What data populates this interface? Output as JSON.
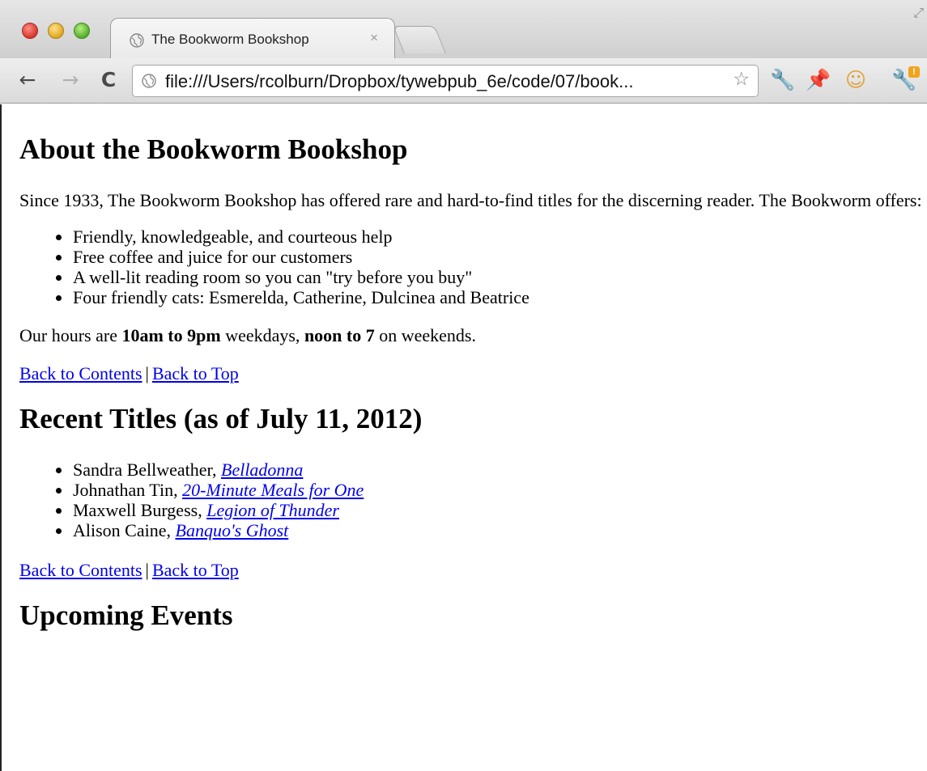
{
  "browser": {
    "tab": {
      "title": "The Bookworm Bookshop",
      "close": "×"
    },
    "address_bar": {
      "url": "file:///Users/rcolburn/Dropbox/tywebpub_6e/code/07/book..."
    },
    "nav": {
      "back": "←",
      "forward": "→",
      "reload": "C"
    },
    "icons": {
      "star": "☆",
      "wrench": "🔧",
      "pin": "📌",
      "face": "☺",
      "settings": "🔧",
      "fullscreen": "⤢"
    },
    "badge": "!"
  },
  "page": {
    "about": {
      "heading": "About the Bookworm Bookshop",
      "intro": "Since 1933, The Bookworm Bookshop has offered rare and hard-to-find titles for the discerning reader. The Bookworm offers:",
      "offers": [
        "Friendly, knowledgeable, and courteous help",
        "Free coffee and juice for our customers",
        "A well-lit reading room so you can \"try before you buy\"",
        "Four friendly cats: Esmerelda, Catherine, Dulcinea and Beatrice"
      ],
      "hours": {
        "prefix": "Our hours are ",
        "weekday_hours": "10am to 9pm",
        "middle": " weekdays, ",
        "weekend_hours": "noon to 7",
        "suffix": " on weekends."
      }
    },
    "nav_links": {
      "contents": "Back to Contents",
      "separator": "|",
      "top": "Back to Top"
    },
    "recent": {
      "heading": "Recent Titles (as of July 11, 2012)",
      "titles": [
        {
          "author": "Sandra Bellweather, ",
          "title": "Belladonna"
        },
        {
          "author": "Johnathan Tin, ",
          "title": "20-Minute Meals for One"
        },
        {
          "author": "Maxwell Burgess, ",
          "title": "Legion of Thunder"
        },
        {
          "author": "Alison Caine, ",
          "title": "Banquo's Ghost"
        }
      ]
    },
    "events": {
      "heading": "Upcoming Events"
    }
  },
  "colors": {
    "link": "#0000ee",
    "text": "#000000",
    "chrome": "#d9d9d9"
  }
}
